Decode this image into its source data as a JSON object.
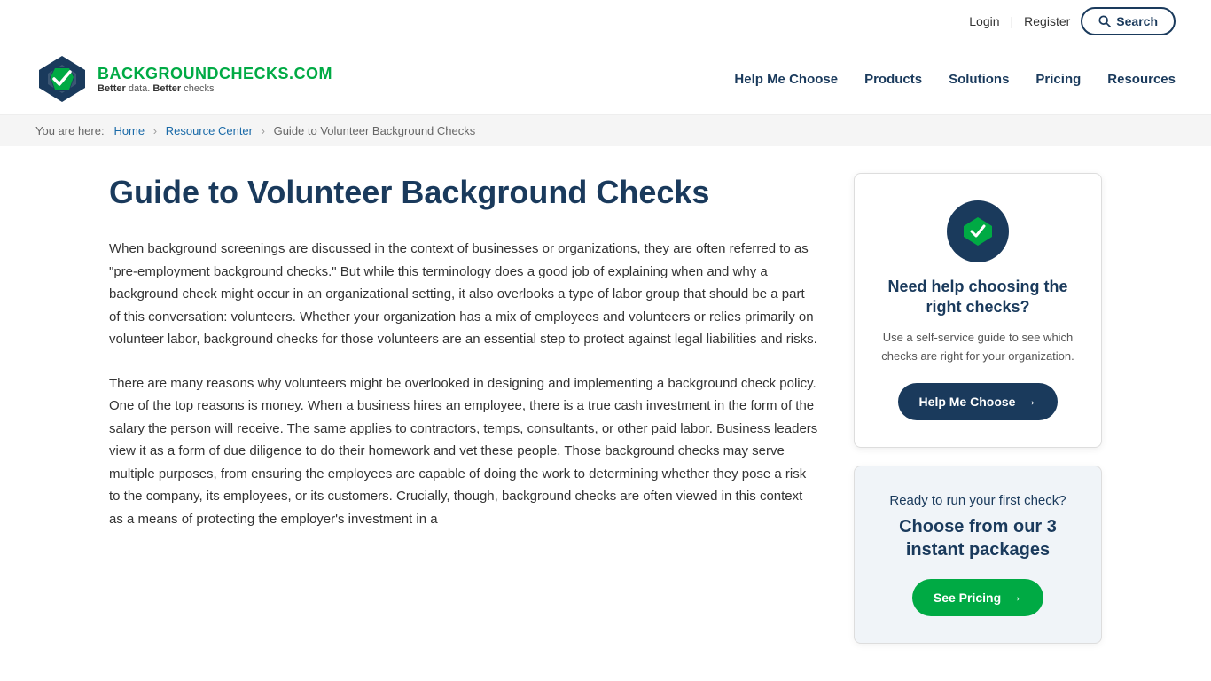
{
  "topbar": {
    "login_label": "Login",
    "register_label": "Register",
    "search_label": "Search"
  },
  "nav": {
    "logo_brand_part1": "BACKGROUND",
    "logo_brand_part2": "CHECKS.COM",
    "logo_tagline": "Better data. Better checks",
    "links": [
      {
        "label": "Help Me Choose",
        "id": "help-me-choose"
      },
      {
        "label": "Products",
        "id": "products"
      },
      {
        "label": "Solutions",
        "id": "solutions"
      },
      {
        "label": "Pricing",
        "id": "pricing"
      },
      {
        "label": "Resources",
        "id": "resources"
      }
    ]
  },
  "breadcrumb": {
    "prefix": "You are here:",
    "items": [
      {
        "label": "Home",
        "href": "#"
      },
      {
        "label": "Resource Center",
        "href": "#"
      },
      {
        "label": "Guide to Volunteer Background Checks"
      }
    ]
  },
  "article": {
    "title": "Guide to Volunteer Background Checks",
    "paragraphs": [
      "When background screenings are discussed in the context of businesses or organizations, they are often referred to as \"pre-employment background checks.\" But while this terminology does a good job of explaining when and why a background check might occur in an organizational setting, it also overlooks a type of labor group that should be a part of this conversation: volunteers. Whether your organization has a mix of employees and volunteers or relies primarily on volunteer labor, background checks for those volunteers are an essential step to protect against legal liabilities and risks.",
      "There are many reasons why volunteers might be overlooked in designing and implementing a background check policy. One of the top reasons is money. When a business hires an employee, there is a true cash investment in the form of the salary the person will receive. The same applies to contractors, temps, consultants, or other paid labor. Business leaders view it as a form of due diligence to do their homework and vet these people. Those background checks may serve multiple purposes, from ensuring the employees are capable of doing the work to determining whether they pose a risk to the company, its employees, or its customers. Crucially, though, background checks are often viewed in this context as a means of protecting the employer's investment in a"
    ]
  },
  "sidebar": {
    "card1": {
      "heading": "Need help choosing the right checks?",
      "body": "Use a self-service guide to see which checks are right for your organization.",
      "button_label": "Help Me Choose"
    },
    "card2": {
      "heading1": "Ready to run your first check?",
      "heading2": "Choose from our 3 instant packages",
      "button_label": "See Pricing"
    }
  }
}
